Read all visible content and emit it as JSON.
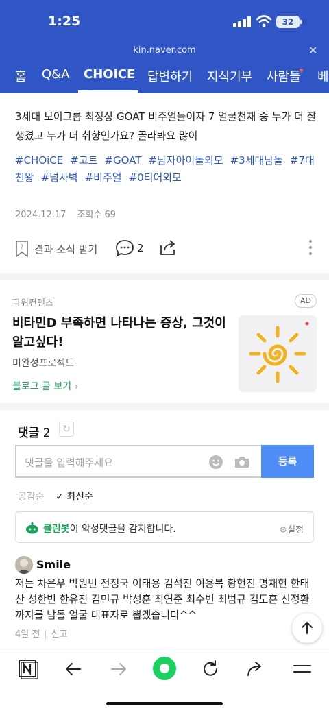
{
  "status_bar": {
    "time": "1:25",
    "battery": "32"
  },
  "browser": {
    "url": "kin.naver.com"
  },
  "tabs": [
    {
      "label": "홈"
    },
    {
      "label": "Q&A"
    },
    {
      "label": "CHOiCE",
      "active": true
    },
    {
      "label": "답변하기"
    },
    {
      "label": "지식기부"
    },
    {
      "label": "사람들"
    },
    {
      "label": "베"
    }
  ],
  "post": {
    "title": "3세대 보이그룹 최정상 GOAT 비주얼들이자 7 얼굴천재 중 누가 더 잘생겼고 누가 더 취향인가요? 골라봐요 많이",
    "hashtags": [
      "#CHOiCE",
      "#고트",
      "#GOAT",
      "#남자아이돌외모",
      "#3세대남돌",
      "#7대천왕",
      "#넘사벽",
      "#비주얼",
      "#0티어외모"
    ],
    "date": "2024.12.17",
    "views": "조회수 69",
    "follow_label": "결과 소식 받기",
    "comment_count": "2"
  },
  "ad": {
    "label": "파워컨텐츠",
    "badge": "AD",
    "title": "비타민D 부족하면 나타나는 증상, 그것이 알고싶다!",
    "sponsor": "미완성프로젝트",
    "link": "블로그 글 보기"
  },
  "comments": {
    "header": "댓글",
    "count": "2",
    "input_placeholder": "댓글을 입력해주세요",
    "submit_label": "등록",
    "sort_popular": "공감순",
    "sort_latest": "최신순",
    "bot_name": "클린봇",
    "bot_message": "이 악성댓글을 감지합니다.",
    "bot_settings": "설정",
    "items": [
      {
        "user": "Smile",
        "text": "저는 차은우 박원빈 전정국 이태용 김석진 이용복 황현진 명재현 한태산 성한빈 한유진 김민규 박성훈 최연준 최수빈 최범규 김도훈 신정환 까지를 남돌 얼굴 대표자로 뽑겠습니다^^",
        "time": "4일 전",
        "report": "신고"
      }
    ]
  },
  "colors": {
    "brand_blue": "#2f56c4",
    "naver_green": "#1aa35a",
    "submit_blue": "#4f8df7"
  },
  "icons": [
    "signal-icon",
    "wifi-icon",
    "battery-icon",
    "close-icon",
    "bookmark-icon",
    "comment-icon",
    "share-icon",
    "more-icon",
    "refresh-icon",
    "smile-icon",
    "camera-icon",
    "check-icon",
    "clean-bot-icon",
    "gear-icon",
    "arrow-up-icon",
    "naver-icon",
    "back-icon",
    "forward-icon",
    "green-dot-icon",
    "reload-icon",
    "share-out-icon",
    "menu-icon"
  ]
}
